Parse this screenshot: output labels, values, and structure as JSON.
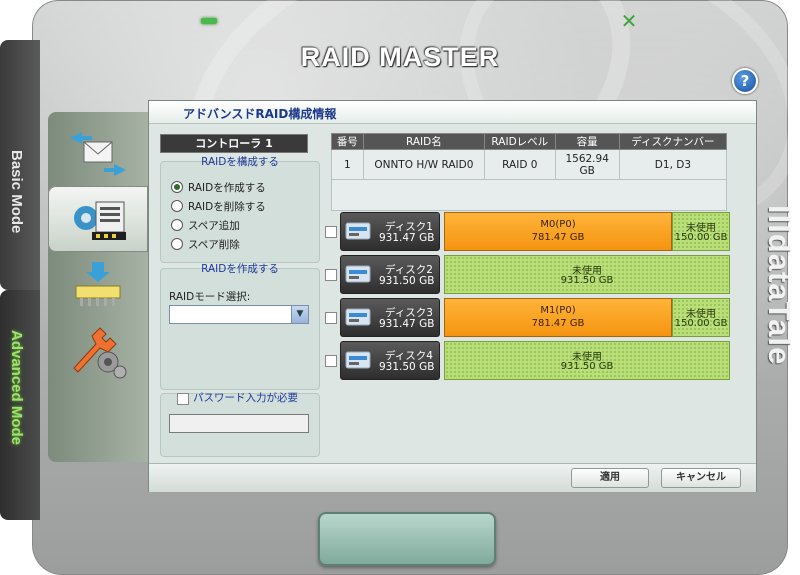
{
  "app": {
    "title": "RAID MASTER",
    "brand": "IIIdataTale",
    "help_glyph": "?",
    "close_glyph": "✕"
  },
  "modes": {
    "basic_label": "Basic Mode",
    "advanced_label": "Advanced Mode"
  },
  "side_icons": [
    "transfer-icon",
    "raid-config-icon",
    "raid-install-icon",
    "tools-icon"
  ],
  "panel": {
    "title": "アドバンスドRAID構成情報",
    "controller_label": "コントローラ 1",
    "config_group": {
      "legend": "RAIDを構成する",
      "options": [
        {
          "label": "RAIDを作成する",
          "selected": true
        },
        {
          "label": "RAIDを削除する",
          "selected": false
        },
        {
          "label": "スペア追加",
          "selected": false
        },
        {
          "label": "スペア削除",
          "selected": false
        }
      ]
    },
    "create_group": {
      "legend": "RAIDを作成する",
      "mode_label": "RAIDモード選択:",
      "mode_value": "",
      "arrow_glyph": "▼"
    },
    "password": {
      "label": "パスワード入力が必要",
      "value": ""
    },
    "table": {
      "headers": [
        "番号",
        "RAID名",
        "RAIDレベル",
        "容量",
        "ディスクナンバー"
      ],
      "rows": [
        [
          "1",
          "ONNTO H/W RAID0",
          "RAID 0",
          "1562.94 GB",
          "D1, D3"
        ]
      ]
    },
    "disks": [
      {
        "name": "ディスク1",
        "size": "931.47 GB",
        "segments": [
          {
            "type": "raid",
            "label": "M0(P0)",
            "size": "781.47 GB"
          },
          {
            "type": "free",
            "label": "未使用",
            "size": "150.00 GB"
          }
        ]
      },
      {
        "name": "ディスク2",
        "size": "931.50 GB",
        "segments": [
          {
            "type": "free",
            "label": "未使用",
            "size": "931.50 GB"
          }
        ]
      },
      {
        "name": "ディスク3",
        "size": "931.47 GB",
        "segments": [
          {
            "type": "raid",
            "label": "M1(P0)",
            "size": "781.47 GB"
          },
          {
            "type": "free",
            "label": "未使用",
            "size": "150.00 GB"
          }
        ]
      },
      {
        "name": "ディスク4",
        "size": "931.50 GB",
        "segments": [
          {
            "type": "free",
            "label": "未使用",
            "size": "931.50 GB"
          }
        ]
      }
    ],
    "buttons": {
      "apply": "適用",
      "cancel": "キャンセル"
    }
  },
  "colors": {
    "raid_segment": "#f49410",
    "free_segment": "#b9de7a",
    "advanced_mode_text": "#9fe36a",
    "panel_title": "#1c3a8c"
  }
}
